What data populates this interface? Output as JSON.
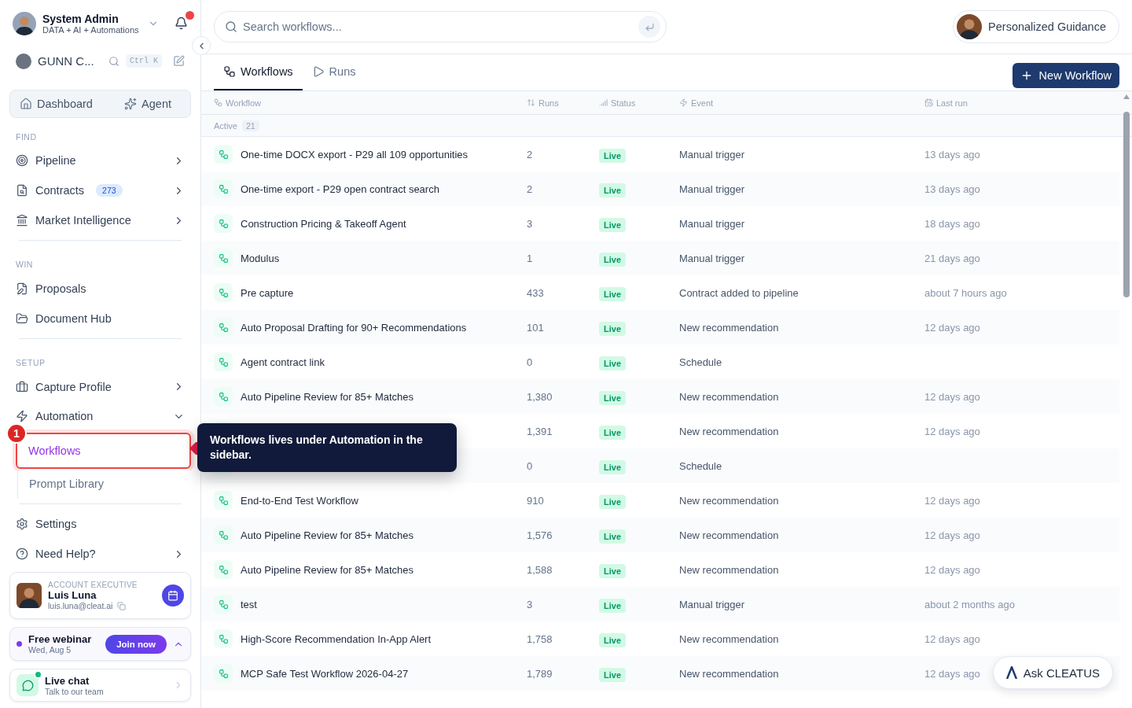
{
  "sidebar": {
    "user": {
      "name": "System Admin",
      "subtitle": "DATA + AI + Automations",
      "unread": true
    },
    "org": {
      "name": "GUNN C...",
      "shortcut": "Ctrl K"
    },
    "quick": [
      {
        "label": "Dashboard"
      },
      {
        "label": "Agent"
      }
    ],
    "sections": [
      {
        "title": "FIND",
        "items": [
          {
            "label": "Pipeline"
          },
          {
            "label": "Contracts",
            "badge": "273"
          },
          {
            "label": "Market Intelligence"
          }
        ]
      },
      {
        "title": "WIN",
        "items": [
          {
            "label": "Proposals"
          },
          {
            "label": "Document Hub"
          }
        ]
      },
      {
        "title": "SETUP",
        "items": [
          {
            "label": "Capture Profile"
          },
          {
            "label": "Automation",
            "expanded": true,
            "children": [
              {
                "label": "Workflows",
                "selected": true,
                "step": "1"
              },
              {
                "label": "Prompt Library",
                "selected": false
              }
            ]
          }
        ]
      },
      {
        "items": [
          {
            "label": "Settings"
          },
          {
            "label": "Need Help?"
          }
        ]
      }
    ],
    "contact": {
      "role": "ACCOUNT EXECUTIVE",
      "name": "Luis Luna",
      "email": "luis.luna@cleat.ai"
    },
    "webinar": {
      "title": "Free webinar",
      "date": "Wed, Aug 5",
      "action": "Join now"
    },
    "chat": {
      "title": "Live chat",
      "subtitle": "Talk to our team",
      "online": true
    }
  },
  "search": {
    "placeholder": "Search workflows..."
  },
  "guidance": {
    "label": "Personalized Guidance"
  },
  "tabs": [
    {
      "label": "Workflows",
      "selected": true
    },
    {
      "label": "Runs",
      "selected": false
    }
  ],
  "new_button": "New Workflow",
  "table": {
    "columns": [
      {
        "label": "Workflow"
      },
      {
        "label": "Runs"
      },
      {
        "label": "Status"
      },
      {
        "label": "Event"
      },
      {
        "label": "Last run"
      }
    ],
    "group": {
      "label": "Active",
      "count": "21"
    },
    "rows": [
      {
        "name": "One-time DOCX export - P29 all 109 opportunities",
        "runs": "2",
        "status": "Live",
        "event": "Manual trigger",
        "last_run": "13 days ago"
      },
      {
        "name": "One-time export - P29 open contract search",
        "runs": "2",
        "status": "Live",
        "event": "Manual trigger",
        "last_run": "13 days ago"
      },
      {
        "name": "Construction Pricing & Takeoff Agent",
        "runs": "3",
        "status": "Live",
        "event": "Manual trigger",
        "last_run": "18 days ago"
      },
      {
        "name": "Modulus",
        "runs": "1",
        "status": "Live",
        "event": "Manual trigger",
        "last_run": "21 days ago"
      },
      {
        "name": "Pre capture",
        "runs": "433",
        "status": "Live",
        "event": "Contract added to pipeline",
        "last_run": "about 7 hours ago"
      },
      {
        "name": "Auto Proposal Drafting for 90+ Recommendations",
        "runs": "101",
        "status": "Live",
        "event": "New recommendation",
        "last_run": "12 days ago"
      },
      {
        "name": "Agent contract link",
        "runs": "0",
        "status": "Live",
        "event": "Schedule"
      },
      {
        "name": "Auto Pipeline Review for 85+ Matches",
        "runs": "1,380",
        "status": "Live",
        "event": "New recommendation",
        "last_run": "12 days ago"
      },
      {
        "runs": "1,391",
        "status": "Live",
        "event": "New recommendation",
        "last_run": "12 days ago"
      },
      {
        "runs": "0",
        "status": "Live",
        "event": "Schedule"
      },
      {
        "name": "End-to-End Test Workflow",
        "runs": "910",
        "status": "Live",
        "event": "New recommendation",
        "last_run": "12 days ago"
      },
      {
        "name": "Auto Pipeline Review for 85+ Matches",
        "runs": "1,576",
        "status": "Live",
        "event": "New recommendation",
        "last_run": "12 days ago"
      },
      {
        "name": "Auto Pipeline Review for 85+ Matches",
        "runs": "1,588",
        "status": "Live",
        "event": "New recommendation",
        "last_run": "12 days ago"
      },
      {
        "name": "test",
        "runs": "3",
        "status": "Live",
        "event": "Manual trigger",
        "last_run": "about 2 months ago"
      },
      {
        "name": "High-Score Recommendation In-App Alert",
        "runs": "1,758",
        "status": "Live",
        "event": "New recommendation",
        "last_run": "12 days ago"
      },
      {
        "name": "MCP Safe Test Workflow 2026-04-27",
        "runs": "1,789",
        "status": "Live",
        "event": "New recommendation",
        "last_run": "12 days ago"
      }
    ]
  },
  "tooltip": {
    "text": "Workflows lives under Automation in the sidebar."
  },
  "assistant": {
    "label": "Ask CLEATUS"
  }
}
